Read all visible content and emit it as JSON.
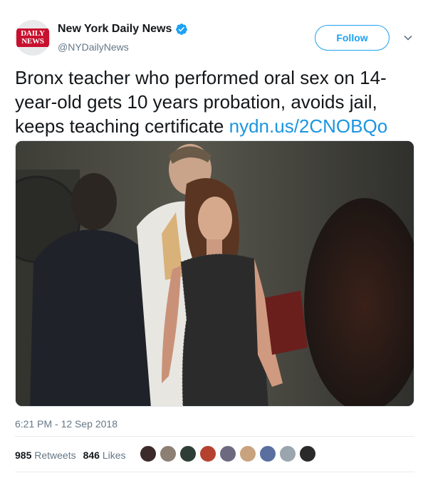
{
  "account": {
    "display_name": "New York Daily News",
    "handle": "@NYDailyNews",
    "avatar_logo_line1": "DAILY",
    "avatar_logo_line2": "NEWS",
    "verified": true
  },
  "follow_label": "Follow",
  "tweet": {
    "text": "Bronx teacher who performed oral sex on 14-year-old gets 10 years probation, avoids jail, keeps teaching certificate ",
    "link": "nydn.us/2CNOBQo"
  },
  "timestamp": "6:21 PM - 12 Sep 2018",
  "stats": {
    "retweets_count": "985",
    "retweets_label": "Retweets",
    "likes_count": "846",
    "likes_label": "Likes"
  },
  "likers": [
    {
      "color": "#3b2a2a"
    },
    {
      "color": "#8c7f74"
    },
    {
      "color": "#2e3d36"
    },
    {
      "color": "#b5422f"
    },
    {
      "color": "#6d6a80"
    },
    {
      "color": "#c9a27e"
    },
    {
      "color": "#5a6fa0"
    },
    {
      "color": "#9aa5ae"
    },
    {
      "color": "#2a2a2a"
    }
  ],
  "colors": {
    "accent": "#1da1f2",
    "link": "#1b95e0",
    "muted": "#657786",
    "brand_red": "#c8102e"
  },
  "icons": {
    "verified": "verified-badge-icon",
    "caret": "chevron-down-icon"
  }
}
